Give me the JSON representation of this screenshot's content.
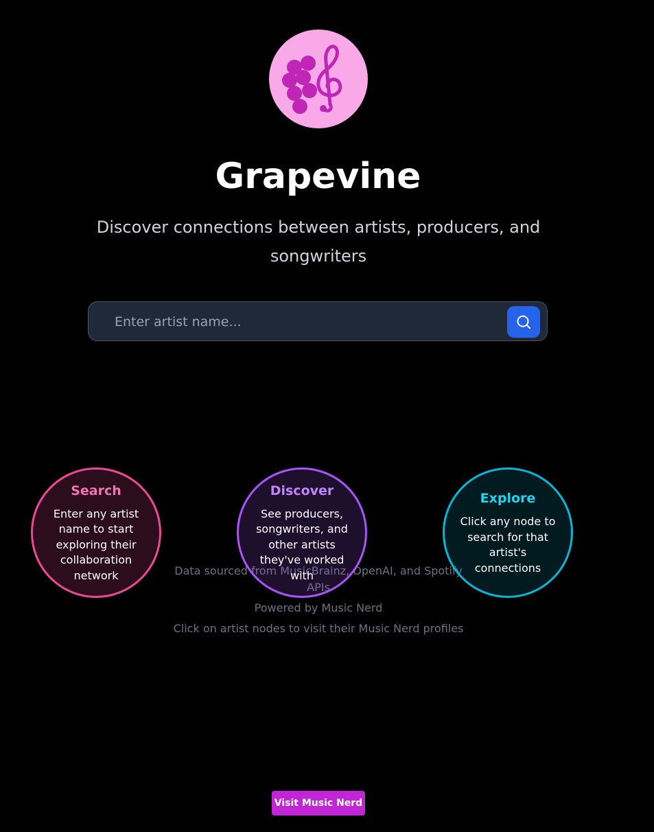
{
  "app": {
    "title": "Grapevine",
    "subtitle": "Discover connections between artists, producers, and songwriters",
    "logo_icon": "grape-treble-clef-icon",
    "colors": {
      "logo_background": "#f9a8e8",
      "logo_glyph": "#c026b5",
      "accent_blue": "#2563eb",
      "accent_magenta": "#c026d3"
    }
  },
  "search": {
    "placeholder": "Enter artist name...",
    "value": "",
    "button_icon": "search-icon"
  },
  "features": [
    {
      "title": "Search",
      "text": "Enter any artist name to start exploring their collaboration network",
      "color": "#ec4899"
    },
    {
      "title": "Discover",
      "text": "See producers, songwriters, and other artists they've worked with",
      "color": "#a855f7"
    },
    {
      "title": "Explore",
      "text": "Click any node to search for that artist's connections",
      "color": "#06b6d4"
    }
  ],
  "credits": {
    "data_source": "Data sourced from MusicBrainz, OpenAI, and Spotify APIs",
    "powered_by": "Powered by Music Nerd",
    "hint": "Click on artist nodes to visit their Music Nerd profiles"
  },
  "footer": {
    "visit_button_label": "Visit Music Nerd"
  }
}
